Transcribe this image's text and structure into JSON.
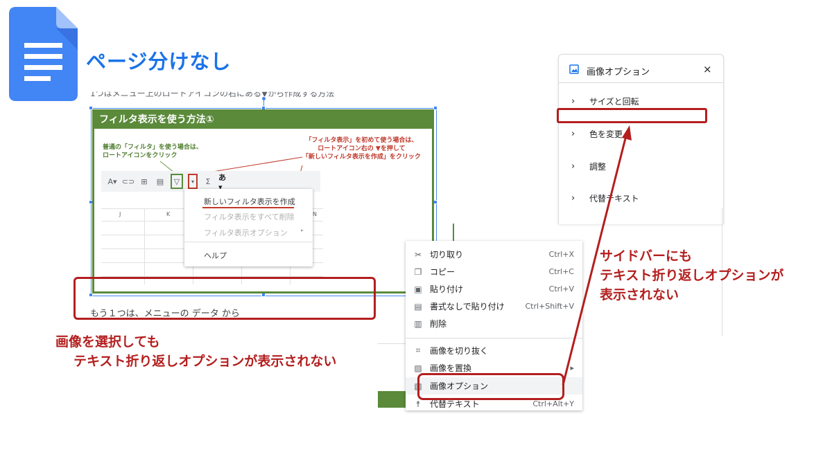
{
  "page_title": "ページ分けなし",
  "doc": {
    "text_top": "1つはメニュー上のロートアイコンの右にある▼から作成する方法",
    "text_bottom": "もう１つは、メニューの データ から"
  },
  "embedded_image": {
    "header": "フィルタ表示を使う方法①",
    "annotation_green": [
      "普通の「フィルタ」を使う場合は、",
      "ロートアイコンをクリック"
    ],
    "annotation_red": [
      "「フィルタ表示」を初めて使う場合は、",
      "ロートアイコン右の ▼を押して",
      "「新しいフィルタ表示を作成」をクリック"
    ],
    "columns": [
      "J",
      "K",
      "N"
    ],
    "menu_items": [
      {
        "label": "新しいフィルタ表示を作成"
      },
      {
        "label": "フィルタ表示をすべて削除"
      },
      {
        "label": "フィルタ表示オプション"
      },
      {
        "label": "ヘルプ"
      }
    ]
  },
  "context_menu": {
    "items": [
      {
        "icon": "scissors-icon",
        "label": "切り取り",
        "shortcut": "Ctrl+X"
      },
      {
        "icon": "copy-icon",
        "label": "コピー",
        "shortcut": "Ctrl+C"
      },
      {
        "icon": "paste-icon",
        "label": "貼り付け",
        "shortcut": "Ctrl+V"
      },
      {
        "icon": "paste-plain-icon",
        "label": "書式なしで貼り付け",
        "shortcut": "Ctrl+Shift+V"
      },
      {
        "icon": "trash-icon",
        "label": "削除",
        "shortcut": ""
      },
      {
        "icon": "crop-icon",
        "label": "画像を切り抜く",
        "shortcut": ""
      },
      {
        "icon": "replace-image-icon",
        "label": "画像を置換",
        "shortcut": "▸"
      },
      {
        "icon": "image-options-icon",
        "label": "画像オプション",
        "shortcut": ""
      },
      {
        "icon": "alt-text-icon",
        "label": "代替テキスト",
        "shortcut": "Ctrl+Alt+Y"
      }
    ]
  },
  "sidebar": {
    "title": "画像オプション",
    "close": "×",
    "items": [
      {
        "label": "サイズと回転"
      },
      {
        "label": "色を変更"
      },
      {
        "label": "調整"
      },
      {
        "label": "代替テキスト"
      }
    ]
  },
  "annotations": {
    "left": [
      "画像を選択しても",
      "テキスト折り返しオプションが表示されない"
    ],
    "right": [
      "サイドバーにも",
      "テキスト折り返しオプションが",
      "表示されない"
    ]
  },
  "colors": {
    "docs_blue": "#4285f4",
    "title_blue": "#1a73e8",
    "red": "#b41e1e",
    "green": "#5a8a3a"
  }
}
